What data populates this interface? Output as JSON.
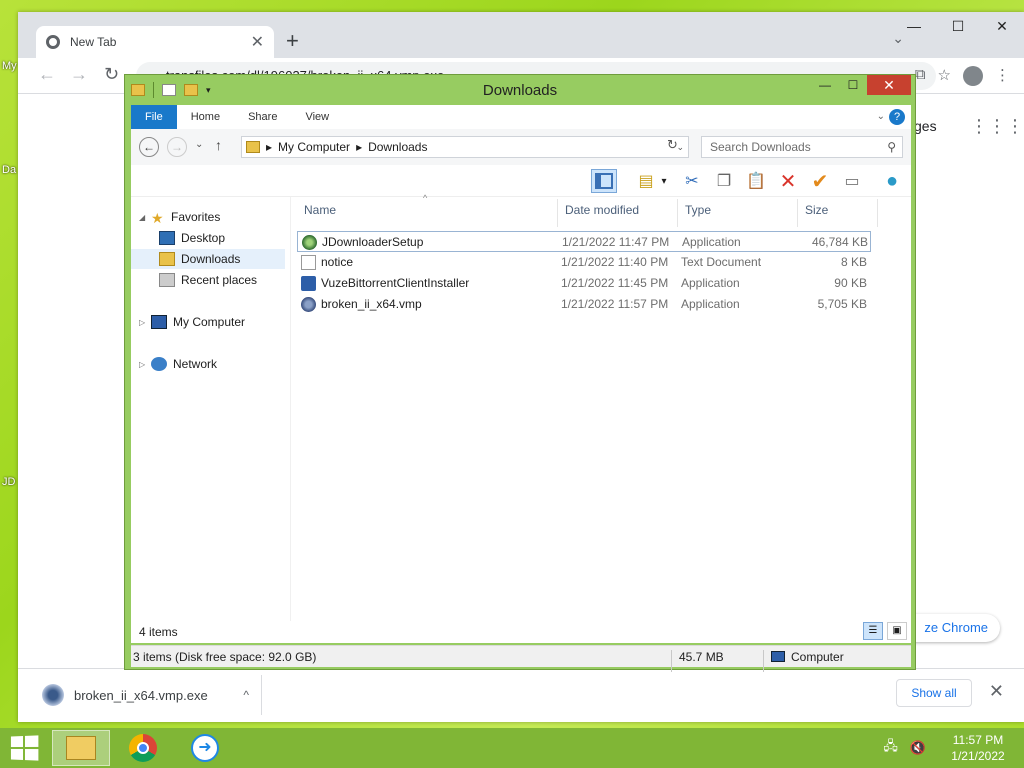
{
  "desktop": {
    "labels": [
      "My",
      "Da",
      "JD"
    ]
  },
  "chrome": {
    "tab_title": "New Tab",
    "tab_close": "✕",
    "new_tab": "+",
    "tab_menu": "⌄",
    "win_min": "—",
    "win_max": "☐",
    "win_close": "✕",
    "back": "←",
    "forward": "→",
    "reload": "↻",
    "address": "transfiles.com/dl/196037/broken_ii_x64.vmp.exe",
    "ext_icon": "⧉",
    "star_icon": "☆",
    "menu_icon": "⋮",
    "ntp_pages": "ges",
    "apps_icon": "⋮⋮⋮",
    "customize_label": "ze Chrome",
    "download_file": "broken_ii_x64.vmp.exe",
    "download_chevron": "^",
    "show_all": "Show all",
    "close_bar": "✕"
  },
  "explorer": {
    "title": "Downloads",
    "min": "—",
    "max": "☐",
    "close": "✕",
    "ribbon_tabs": {
      "file": "File",
      "home": "Home",
      "share": "Share",
      "view": "View"
    },
    "ribbon_chevron": "⌄",
    "help": "?",
    "nav_back": "←",
    "nav_forward": "→",
    "nav_recent": "⌄",
    "nav_up": "↑",
    "breadcrumb": {
      "root": "My Computer",
      "sep": "▸",
      "current": "Downloads"
    },
    "addr_drop": "⌄",
    "refresh": "↻",
    "search_placeholder": "Search Downloads",
    "search_icon": "⚲",
    "toolbar": {
      "props_caret": "▾",
      "cut": "✂",
      "copy": "❐",
      "paste": "📋",
      "delete": "✕",
      "rename": "✔",
      "props": "▭",
      "globe": "●"
    },
    "navpane": {
      "favorites": "Favorites",
      "desktop": "Desktop",
      "downloads": "Downloads",
      "recent": "Recent places",
      "mycomputer": "My Computer",
      "network": "Network",
      "expanded": "◢",
      "collapsed": "▷"
    },
    "columns": {
      "name": "Name",
      "date": "Date modified",
      "type": "Type",
      "size": "Size",
      "sort_caret": "^"
    },
    "files": [
      {
        "name": "JDownloaderSetup",
        "date": "1/21/2022 11:47 PM",
        "type": "Application",
        "size": "46,784 KB"
      },
      {
        "name": "notice",
        "date": "1/21/2022 11:40 PM",
        "type": "Text Document",
        "size": "8 KB"
      },
      {
        "name": "VuzeBittorrentClientInstaller",
        "date": "1/21/2022 11:45 PM",
        "type": "Application",
        "size": "90 KB"
      },
      {
        "name": "broken_ii_x64.vmp",
        "date": "1/21/2022 11:57 PM",
        "type": "Application",
        "size": "5,705 KB"
      }
    ],
    "item_count": "4 items",
    "view_details": "☰",
    "view_icons": "▣",
    "status": {
      "selection": "3 items (Disk free space: 92.0 GB)",
      "size": "45.7 MB",
      "location": "Computer"
    }
  },
  "taskbar": {
    "arrow_glyph": "➜",
    "net_icon": "🖧",
    "vol_icon": "🔇",
    "time": "11:57 PM",
    "date": "1/21/2022"
  }
}
